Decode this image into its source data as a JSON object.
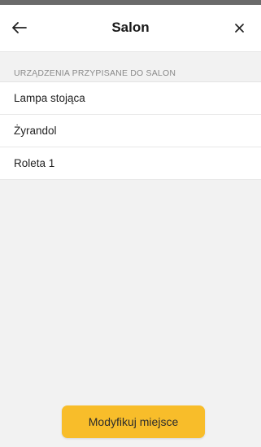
{
  "header": {
    "title": "Salon",
    "back_icon": "arrow-left-icon",
    "close_icon": "close-icon"
  },
  "section": {
    "label": "URZĄDZENIA PRZYPISANE DO SALON"
  },
  "devices": [
    {
      "name": "Lampa stojąca"
    },
    {
      "name": "Żyrandol"
    },
    {
      "name": "Roleta 1"
    }
  ],
  "footer": {
    "modify_label": "Modyfikuj miejsce"
  },
  "colors": {
    "accent": "#f8bd2a",
    "background": "#f2f2f2",
    "surface": "#ffffff"
  }
}
